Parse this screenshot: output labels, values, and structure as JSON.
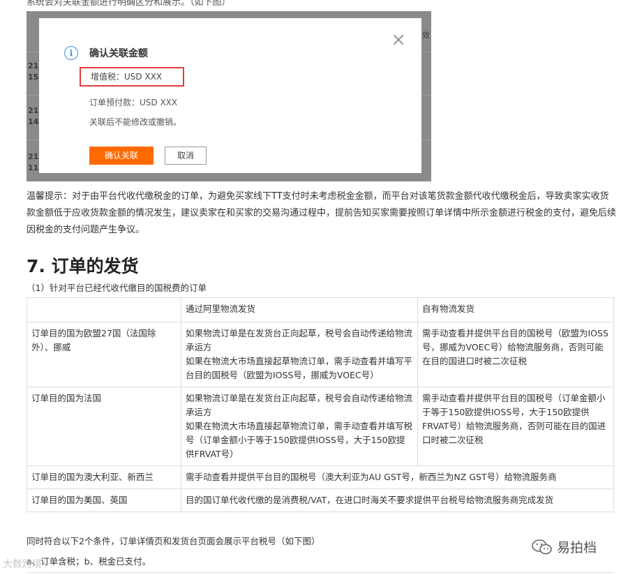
{
  "top_partial_text": "系统会对关联金额进行明确区分和展示。（如下图）",
  "screenshot": {
    "bg_left_fragments": [
      "21",
      "15:",
      "21",
      "14:",
      "21",
      "11:"
    ],
    "bg_right_fragment": "效",
    "modal": {
      "title": "确认关联金额",
      "vat_line": "增值税：USD XXX",
      "prepay_line": "订单预付款：USD XXX",
      "note": "关联后不能修改或撤销。",
      "confirm_button": "确认关联",
      "cancel_button": "取消",
      "close_symbol": "×",
      "info_symbol": "i"
    }
  },
  "tip_text": "温馨提示：对于由平台代收代缴税金的订单，为避免买家线下TT支付时未考虑税金金额，而平台对该笔货款金额代收代缴税金后，导致卖家实收货款金额低于应收货款金额的情况发生，建议卖家在和买家的交易沟通过程中，提前告知买家需要按照订单详情中所示金额进行税金的支付，避免后续因税金的支付问题产生争议。",
  "section_heading": "7. 订单的发货",
  "section_sub": "（1）针对平台已经代收代缴目的国税费的订单",
  "table": {
    "headers": [
      "",
      "通过阿里物流发货",
      "自有物流发货"
    ],
    "rows": [
      {
        "label": "订单目的国为欧盟27国（法国除外）、挪威",
        "ali": "如果物流订单是在发货台正向起草，税号会自动传递给物流承运方\n如果在物流大市场直接起草物流订单，需手动查看并填写平台目的国税号（欧盟为IOSS号，挪威为VOEC号）",
        "own": "需手动查看并提供平台目的国税号（欧盟为IOSS号，挪威为VOEC号）给物流服务商，否则可能在目的国进口时被二次征税"
      },
      {
        "label": "订单目的国为法国",
        "ali": "如果物流订单是在发货台正向起草，税号会自动传递给物流承运方\n如果在物流大市场直接起草物流订单，需手动查看并填写税号（订单金额小于等于150欧提供IOSS号，大于150欧提供FRVAT号）",
        "own": "需手动查看并提供平台目的国税号（订单金额小于等于150欧提供IOSS号，大于150欧提供FRVAT号）给物流服务商，否则可能在目的国进口时被二次征税"
      },
      {
        "label": "订单目的国为澳大利亚、新西兰",
        "merged": "需手动查看并提供平台目的国税号（澳大利亚为AU GST号，新西兰为NZ GST号）给物流服务商"
      },
      {
        "label": "订单目的国为美国、英国",
        "merged": "目的国订单代收代缴的是消费税/VAT，在进口时海关不要求提供平台税号给物流服务商完成发货"
      }
    ]
  },
  "after_text_1": "同时符合以下2个条件，订单详情页和发货台页面会展示平台税号（如下图）",
  "after_text_2": "a、订单含税；b、税金已支付。",
  "watermark_right": "易拍档",
  "watermark_left": "大数跨境"
}
